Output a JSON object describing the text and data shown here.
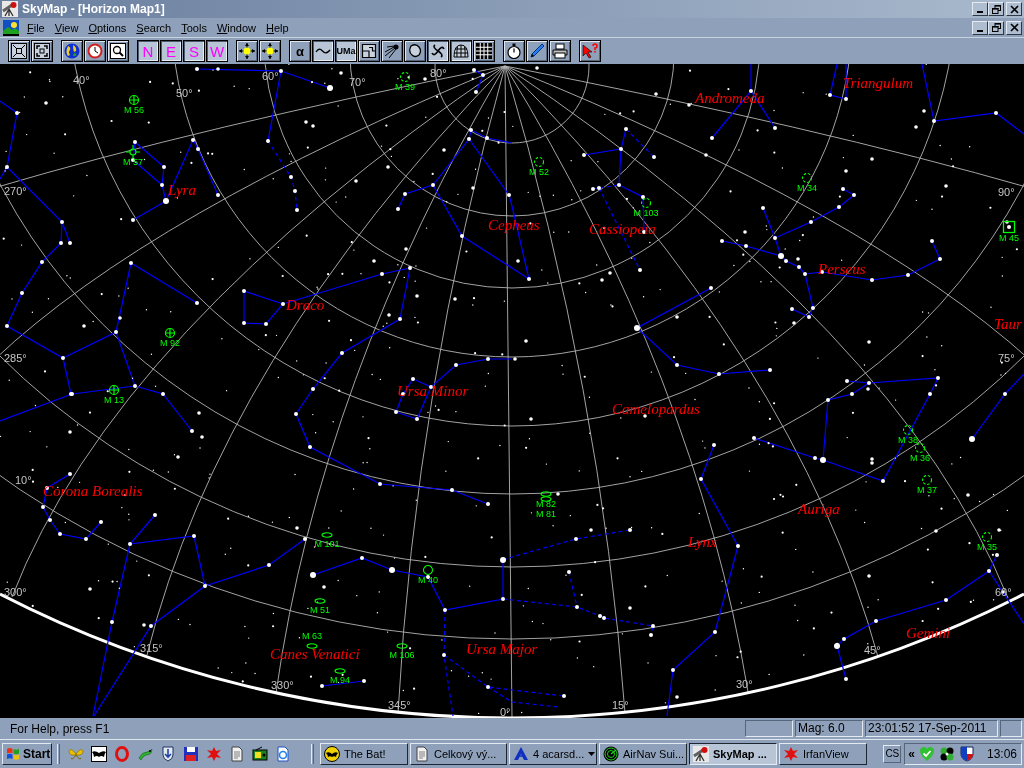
{
  "window": {
    "title": "SkyMap - [Horizon Map1]"
  },
  "menu": [
    "File",
    "View",
    "Options",
    "Search",
    "Tools",
    "Window",
    "Help"
  ],
  "toolbar": [
    {
      "buttons": [
        {
          "kind": "icon",
          "on": false
        },
        {
          "kind": "icon",
          "on": false
        }
      ]
    },
    {
      "buttons": [
        {
          "kind": "icon",
          "on": false
        },
        {
          "kind": "icon",
          "on": false
        },
        {
          "kind": "icon",
          "on": false
        }
      ]
    },
    {
      "buttons": [
        {
          "kind": "text",
          "label": "N",
          "on": true
        },
        {
          "kind": "text",
          "label": "E",
          "on": true
        },
        {
          "kind": "text",
          "label": "S",
          "on": true
        },
        {
          "kind": "text",
          "label": "W",
          "on": true
        }
      ]
    },
    {
      "buttons": [
        {
          "kind": "icon",
          "on": false
        },
        {
          "kind": "icon",
          "on": false
        }
      ]
    },
    {
      "buttons": [
        {
          "kind": "text",
          "label": "α",
          "on": false
        },
        {
          "kind": "icon",
          "on": true
        },
        {
          "kind": "text",
          "label": "UMa",
          "on": true
        },
        {
          "kind": "icon",
          "on": false
        },
        {
          "kind": "icon",
          "on": false
        },
        {
          "kind": "icon",
          "on": false
        },
        {
          "kind": "icon",
          "on": true
        },
        {
          "kind": "icon",
          "on": true
        },
        {
          "kind": "icon",
          "on": false
        }
      ]
    },
    {
      "buttons": [
        {
          "kind": "icon",
          "on": false
        },
        {
          "kind": "icon",
          "on": false
        },
        {
          "kind": "icon",
          "on": false
        }
      ]
    },
    {
      "buttons": [
        {
          "kind": "icon",
          "on": false
        }
      ]
    }
  ],
  "map": {
    "grid_labels": [
      "40°",
      "50°",
      "60°",
      "70°",
      "80°",
      "270°",
      "90°",
      "285°",
      "75°",
      "10°",
      "300°",
      "60°",
      "315°",
      "45°",
      "330°",
      "30°",
      "345°",
      "15°",
      "0°"
    ],
    "constellations": [
      "Triangulum",
      "Andromeda",
      "Lyra",
      "Cepheus",
      "Cassiopeia",
      "Perseus",
      "Draco",
      "Taur",
      "Ursa Minor",
      "Camelopardus",
      "Corona Borealis",
      "Auriga",
      "Lynx",
      "Gemini",
      "Ursa Major",
      "Canes Venatici"
    ],
    "messier_objects": [
      {
        "label": "M 39",
        "kind": "open"
      },
      {
        "label": "M 56",
        "kind": "globular"
      },
      {
        "label": "M 57",
        "kind": "planetary"
      },
      {
        "label": "M 52",
        "kind": "open"
      },
      {
        "label": "M 34",
        "kind": "open"
      },
      {
        "label": "M 103",
        "kind": "open"
      },
      {
        "label": "M 45",
        "kind": "marked"
      },
      {
        "label": "M 92",
        "kind": "globular"
      },
      {
        "label": "M 13",
        "kind": "globular"
      },
      {
        "label": "M 38",
        "kind": "open"
      },
      {
        "label": "M 36",
        "kind": "open"
      },
      {
        "label": "M 37",
        "kind": "open"
      },
      {
        "label": "M 82",
        "kind": "galaxy"
      },
      {
        "label": "M 81",
        "kind": "galaxy"
      },
      {
        "label": "M 101",
        "kind": "galaxy"
      },
      {
        "label": "M 35",
        "kind": "open"
      },
      {
        "label": "M 40",
        "kind": "double"
      },
      {
        "label": "M 51",
        "kind": "galaxy"
      },
      {
        "label": "M 63",
        "kind": "galaxy"
      },
      {
        "label": "M 106",
        "kind": "galaxy"
      },
      {
        "label": "M 94",
        "kind": "galaxy"
      }
    ]
  },
  "status_bar": {
    "help": "For Help, press F1",
    "magnitude": "Mag: 6.0",
    "datetime": "23:01:52 17-Sep-2011"
  },
  "taskbar": {
    "start": "Start",
    "tasks": [
      {
        "label": "The Bat!",
        "selected": false,
        "grouped": false
      },
      {
        "label": "Celkový vý...",
        "selected": false,
        "grouped": false
      },
      {
        "label": "4 acarsd...",
        "selected": false,
        "grouped": true
      },
      {
        "label": "AirNav Sui...",
        "selected": false,
        "grouped": false
      },
      {
        "label": "SkyMap ...",
        "selected": true,
        "grouped": false
      },
      {
        "label": "IrfanView",
        "selected": false,
        "grouped": false
      }
    ],
    "language": "CS",
    "tray_expander": "«",
    "clock": "13:06"
  }
}
